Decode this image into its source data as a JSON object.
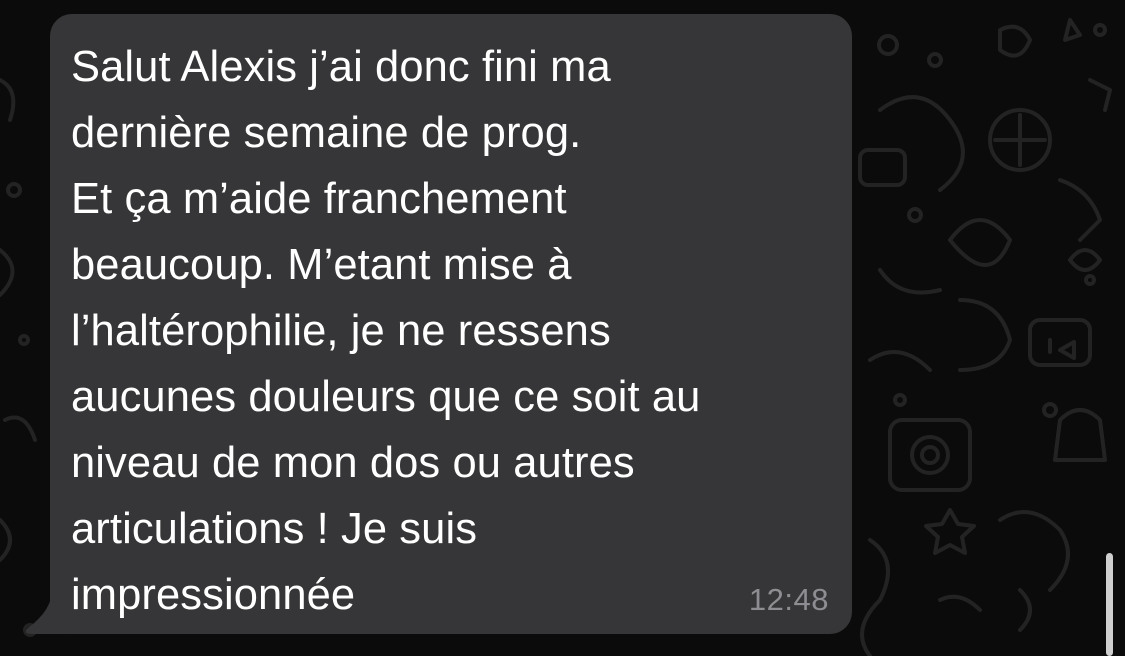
{
  "conversation": {
    "message": {
      "text": "Salut Alexis j’ai donc fini ma\ndernière semaine de prog.\nEt ça m’aide franchement\nbeaucoup. M’etant mise à\nl’haltérophilie, je ne ressens\naucunes douleurs que ce soit au\nniveau de mon dos ou autres\narticulations ! Je suis\nimpressionnée",
      "time": "12:48",
      "direction": "incoming"
    }
  },
  "colors": {
    "background": "#0b0b0b",
    "bubble": "#363638",
    "message_text": "#ffffff",
    "timestamp": "#8e8e92",
    "wallpaper_doodles": "#232323"
  }
}
